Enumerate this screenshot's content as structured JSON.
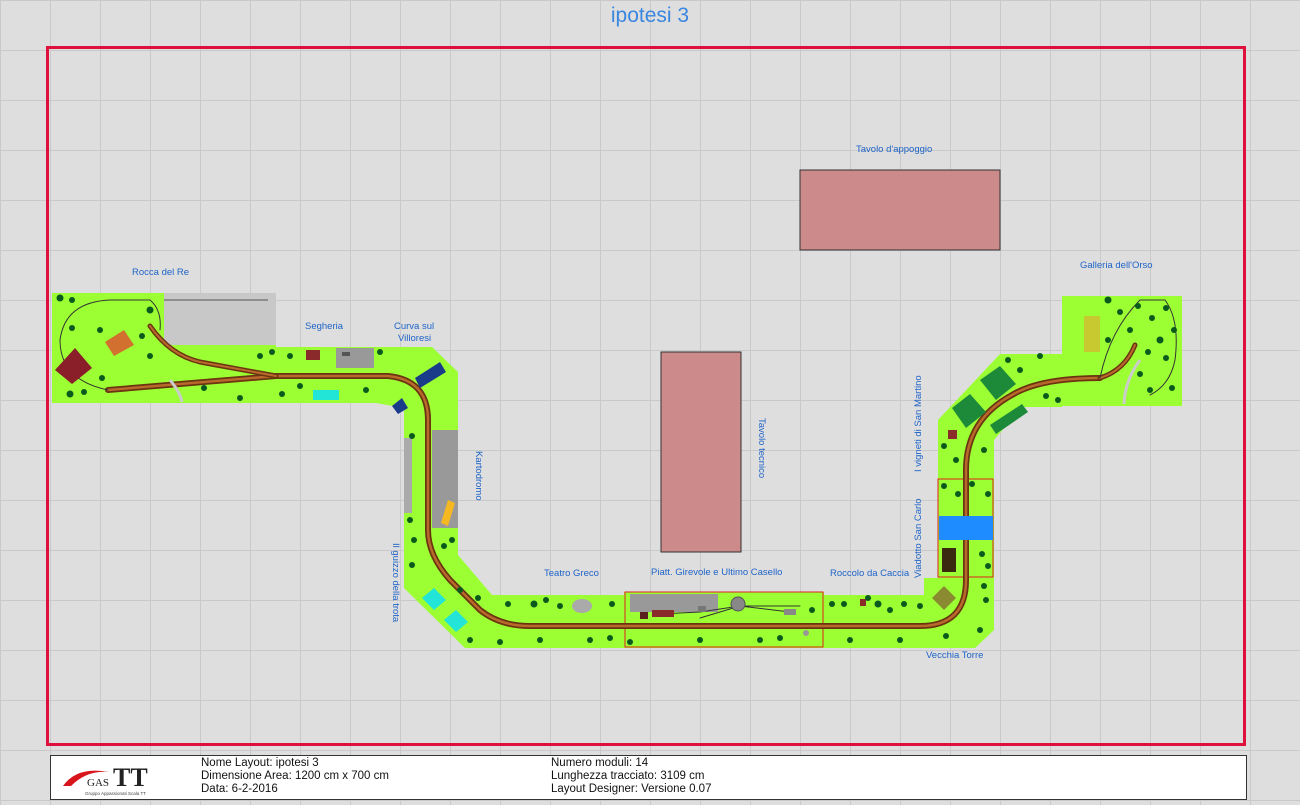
{
  "title": "ipotesi 3",
  "labels": {
    "rocca": "Rocca del Re",
    "segheria": "Segheria",
    "curva1": "Curva sul",
    "curva2": "Villoresi",
    "kartodromo": "Kartodromo",
    "guizzo": "Il guizzo della trota",
    "teatro": "Teatro Greco",
    "piatt": "Piatt. Girevole e Ultimo Casello",
    "roccolo": "Roccolo da Caccia",
    "viadotto": "Viadotto San Carlo",
    "vigneti": "I vigneti di San Martino",
    "torre": "Vecchia Torre",
    "galleria": "Galleria dell'Orso",
    "tavolo_appoggio": "Tavolo d'appoggio",
    "tavolo_tecnico": "Tavolo tecnico"
  },
  "footer": {
    "logo_gas": "GAS",
    "logo_tt": "TT",
    "logo_sub": "Gruppo Appassionati Scala TT",
    "nome_layout": "Nome Layout: ipotesi 3",
    "dimensione": "Dimensione Area: 1200 cm x 700 cm",
    "data": "Data: 6-2-2016",
    "numero_moduli": "Numero moduli: 14",
    "lunghezza": "Lunghezza tracciato: 3109 cm",
    "designer": "Layout Designer: Versione 0.07"
  },
  "colors": {
    "accent": "#3a86e0",
    "frame": "#e0103e",
    "module": "#9cff33",
    "track": "#9a4a1c",
    "table": "#cc8a8a"
  }
}
